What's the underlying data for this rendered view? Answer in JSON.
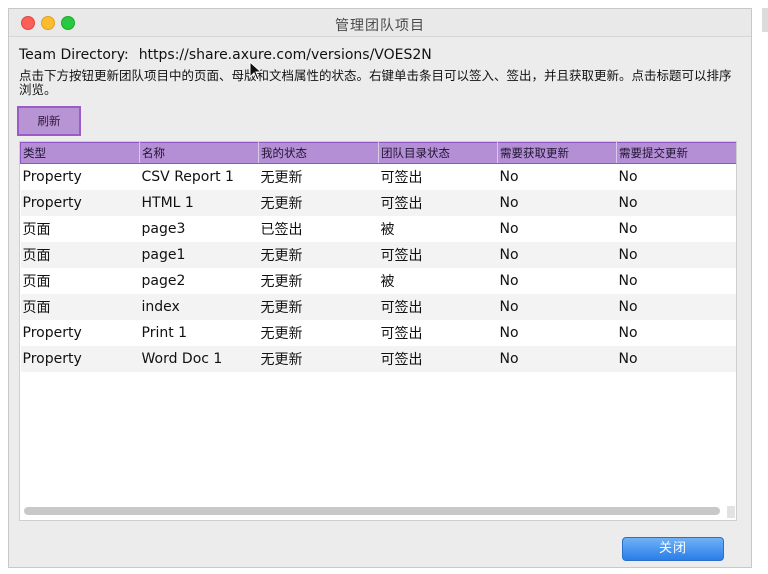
{
  "window": {
    "title": "管理团队项目"
  },
  "team_directory": {
    "label": "Team Directory:",
    "url": "https://share.axure.com/versions/VOES2N"
  },
  "instructions": "点击下方按钮更新团队项目中的页面、母版和文档属性的状态。右键单击条目可以签入、签出，并且获取更新。点击标题可以排序浏览。",
  "toolbar": {
    "refresh_label": "刷新"
  },
  "table": {
    "columns": [
      "类型",
      "名称",
      "我的状态",
      "团队目录状态",
      "需要获取更新",
      "需要提交更新"
    ],
    "rows": [
      [
        "Property",
        "CSV Report 1",
        "无更新",
        "可签出",
        "No",
        "No"
      ],
      [
        "Property",
        "HTML 1",
        "无更新",
        "可签出",
        "No",
        "No"
      ],
      [
        "页面",
        "page3",
        "已签出",
        "被",
        "No",
        "No"
      ],
      [
        "页面",
        "page1",
        "无更新",
        "可签出",
        "No",
        "No"
      ],
      [
        "页面",
        "page2",
        "无更新",
        "被",
        "No",
        "No"
      ],
      [
        "页面",
        "index",
        "无更新",
        "可签出",
        "No",
        "No"
      ],
      [
        "Property",
        "Print 1",
        "无更新",
        "可签出",
        "No",
        "No"
      ],
      [
        "Property",
        "Word Doc 1",
        "无更新",
        "可签出",
        "No",
        "No"
      ]
    ]
  },
  "footer": {
    "close_label": "关闭"
  },
  "colors": {
    "header_bg": "#b58fd6",
    "accent_purple": "#9a5cc8",
    "close_button": "#2a7ee8"
  }
}
